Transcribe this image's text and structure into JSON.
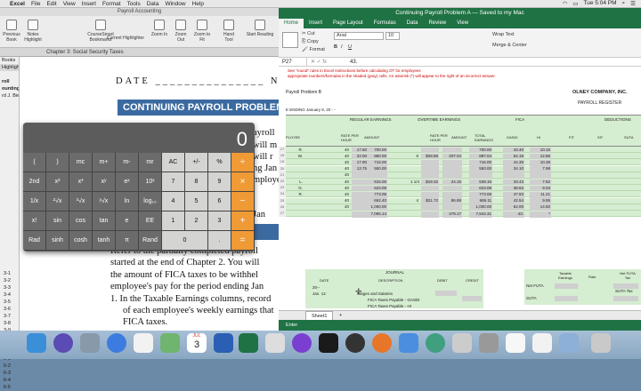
{
  "menubar": {
    "apple": "",
    "items": [
      "Excel",
      "File",
      "Edit",
      "View",
      "Insert",
      "Format",
      "Tools",
      "Data",
      "Window",
      "Help"
    ],
    "clock": "Tue 5:04 PM"
  },
  "reader": {
    "title": "Payroll Accounting",
    "toolbar": [
      "Previous Book",
      "Notes Highlight",
      "CourseSmart Bookmarks",
      "Current Highlighter",
      "Zoom In",
      "Zoom Out",
      "Zoom to Fit",
      "Hand Tool",
      "Start Reading"
    ],
    "tab": "Chapter 3: Social Security Taxes",
    "sidebar": [
      "Books",
      "Highlights",
      "roll",
      "ounting 2...",
      "rd J. Bieg"
    ],
    "sidebar_pages": [
      "3-1",
      "3-2",
      "3-3",
      "3-4",
      "3-5",
      "3-6",
      "3-7",
      "3-8",
      "3-9",
      "3-10",
      "4-1",
      "5-1",
      "6-1",
      "6-2",
      "6-3",
      "6-4",
      "6-5"
    ],
    "date_line": "DATE _______________ NAME",
    "banner": "CONTINUING PAYROLL PROBLEM •",
    "lines": [
      "ayroll",
      "will m",
      "will r",
      "ng Jan",
      "mploye",
      "Jan",
      "Refer to the partially completed payroll",
      "started at the end of Chapter 2. You will",
      "the amount of FICA taxes to be withhel",
      "employee's pay for the period ending Jan",
      "1. In the Taxable Earnings columns, record",
      "of each employee's weekly earnings that",
      "FICA taxes."
    ]
  },
  "calculator": {
    "display": "0",
    "rows": [
      [
        "(",
        ")",
        "mc",
        "m+",
        "m-",
        "mr",
        "AC",
        "+/-",
        "%",
        "÷"
      ],
      [
        "2nd",
        "x²",
        "x³",
        "xʸ",
        "eˣ",
        "10ˣ",
        "7",
        "8",
        "9",
        "×"
      ],
      [
        "1/x",
        "²√x",
        "³√x",
        "ʸ√x",
        "ln",
        "log₁₀",
        "4",
        "5",
        "6",
        "−"
      ],
      [
        "x!",
        "sin",
        "cos",
        "tan",
        "e",
        "EE",
        "1",
        "2",
        "3",
        "+"
      ],
      [
        "Rad",
        "sinh",
        "cosh",
        "tanh",
        "π",
        "Rand",
        "0",
        "",
        ".",
        "="
      ]
    ]
  },
  "excel": {
    "title": "Continuing Payroll Problem A — Saved to my Mac",
    "tabs": [
      "Home",
      "Insert",
      "Page Layout",
      "Formulas",
      "Data",
      "Review",
      "View"
    ],
    "font": "Arial",
    "font_size": "10",
    "cell_ref": "P27",
    "formula": "43.",
    "instructions": [
      "See \"round\" rules in Excel Instructions before calculating OT for employees",
      "appropriate numbers/formulas in the shaded (gray) cells. An asterisk (*) will appear to the right of an incorrect answer."
    ],
    "company": "OLNEY COMPANY, INC.",
    "register": "PAYROLL REGISTER",
    "problem": "Payroll Problem B",
    "week_ending": "E ENDING      January 8, 20 - -",
    "headers": [
      "PLOYEE",
      "MARITAL STATUS",
      "NO. OF W/H ALLOW.",
      "HOURS WORKED",
      "RATE PER HOUR",
      "AMOUNT",
      "HOURS",
      "RATE PER HOUR",
      "AMOUNT",
      "TOTAL EARNINGS",
      "OASDI",
      "HI",
      "FIT",
      "SIT",
      "SUTA"
    ],
    "section_headers": [
      "REGULAR EARNINGS",
      "OVERTIME EARNINGS",
      "FICA",
      "DEDUCTIONS"
    ],
    "rows": [
      [
        "17",
        "R.",
        "40",
        "17.50",
        "700.00",
        "",
        "",
        "",
        "700.00",
        "43.40",
        "10.15"
      ],
      [
        "18",
        "W.",
        "40",
        "22.00",
        "880.00",
        "8",
        "$28.88",
        "207.04",
        "887.04",
        "52.19",
        "12.86"
      ],
      [
        "19",
        "",
        "40",
        "17.90",
        "716.00",
        "",
        "",
        "",
        "716.00",
        "44.39",
        "10.38"
      ],
      [
        "20",
        "",
        "40",
        "13.75",
        "550.00",
        "",
        "",
        "",
        "550.00",
        "34.10",
        "7.98"
      ],
      [
        "21",
        "",
        "40",
        "",
        "",
        "",
        "",
        "",
        "",
        "",
        ""
      ],
      [
        "22",
        "L.",
        "40",
        "",
        "515.00",
        "1 1/4",
        "$19.32",
        "24.15",
        "539.15",
        "33.43",
        "7.82"
      ],
      [
        "23",
        "G.",
        "40",
        "",
        "623.08",
        "",
        "",
        "",
        "623.08",
        "38.63",
        "9.03"
      ],
      [
        "24",
        "R.",
        "40",
        "",
        "773.08",
        "",
        "",
        "",
        "773.08",
        "47.93",
        "11.21"
      ],
      [
        "25",
        "",
        "40",
        "",
        "662.40",
        "4",
        "$21.72",
        "86.88",
        "686.11",
        "42.54",
        "9.95"
      ],
      [
        "26",
        "",
        "40",
        "",
        "1,000.00",
        "",
        "",
        "",
        "1,000.00",
        "62.00",
        "14.50"
      ],
      [
        "27",
        "",
        "",
        "",
        "7,065.14",
        "",
        "",
        "479.17",
        "7,544.31",
        "43.",
        "*"
      ]
    ],
    "journal": {
      "title": "JOURNAL",
      "headers": [
        "DATE",
        "DESCRIPTION",
        "DEBIT",
        "CREDIT"
      ],
      "lines": [
        [
          "20--",
          ""
        ],
        [
          "Jan. 12",
          "Wages and Salaries"
        ],
        [
          "",
          "FICA Taxes Payable - OASDI"
        ],
        [
          "",
          "FICA Taxes Payable - HI"
        ]
      ]
    },
    "side_table": {
      "headers": [
        "Taxable Earnings",
        "Rate",
        "Net FUTA Tax"
      ],
      "rows": [
        "Net FUTA",
        "SUTA"
      ],
      "suta_label": "SUTA Tax"
    },
    "sheet_tab": "Sheet1",
    "status": "Enter"
  },
  "dock": {
    "calendar_month": "JUL",
    "calendar_day": "3"
  }
}
